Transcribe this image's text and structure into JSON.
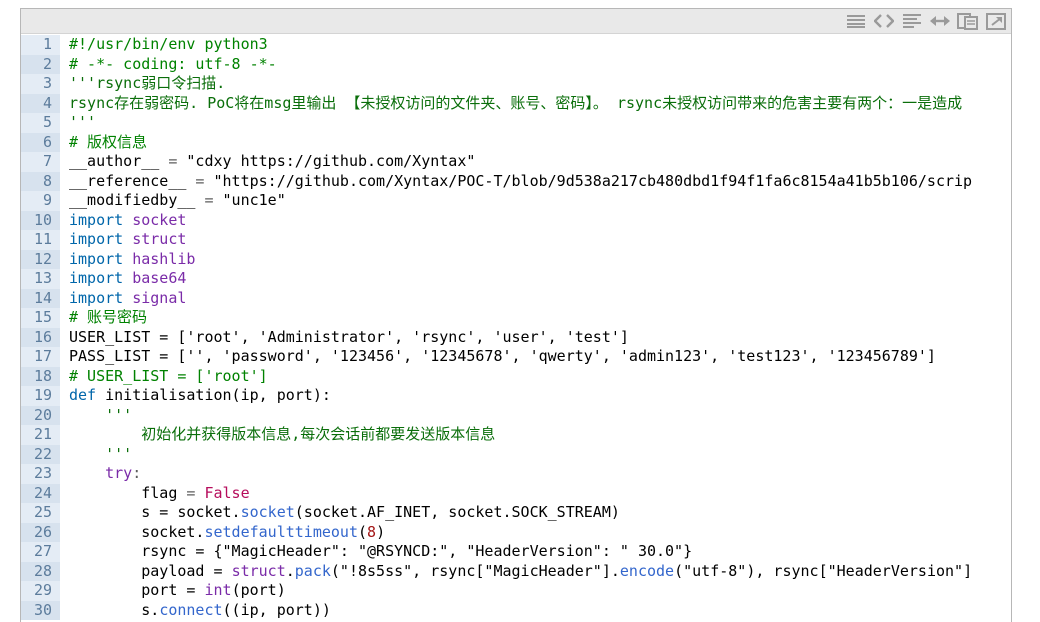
{
  "toolbar": {
    "tools": [
      "view-source-icon",
      "code-tags-icon",
      "wrap-lines-icon",
      "expand-icon",
      "copy-icon",
      "popout-icon"
    ]
  },
  "lines": [
    {
      "n": "1",
      "seg": [
        {
          "t": "#!/usr/bin/env python3",
          "c": "cm"
        }
      ]
    },
    {
      "n": "2",
      "seg": [
        {
          "t": "# -*- coding: utf-8 -*-",
          "c": "cm"
        }
      ]
    },
    {
      "n": "3",
      "seg": [
        {
          "t": "'''rsync弱口令扫描.",
          "c": "st"
        }
      ]
    },
    {
      "n": "4",
      "seg": [
        {
          "t": "rsync存在弱密码. PoC将在msg里输出 【未授权访问的文件夹、账号、密码】。 rsync未授权访问带来的危害主要有两个：一是造成",
          "c": "st"
        }
      ]
    },
    {
      "n": "5",
      "seg": [
        {
          "t": "'''",
          "c": "st"
        }
      ]
    },
    {
      "n": "6",
      "seg": [
        {
          "t": "# 版权信息",
          "c": "cm"
        }
      ]
    },
    {
      "n": "7",
      "seg": [
        {
          "t": "__author__",
          "c": "id"
        },
        {
          "t": " = ",
          "c": "op"
        },
        {
          "t": "\"cdxy https://github.com/Xyntax\"",
          "c": "id"
        }
      ]
    },
    {
      "n": "8",
      "seg": [
        {
          "t": "__reference__",
          "c": "id"
        },
        {
          "t": " = ",
          "c": "op"
        },
        {
          "t": "\"https://github.com/Xyntax/POC-T/blob/9d538a217cb480dbd1f94f1fa6c8154a41b5b106/scrip",
          "c": "id"
        }
      ]
    },
    {
      "n": "9",
      "seg": [
        {
          "t": "__modifiedby__",
          "c": "id"
        },
        {
          "t": " = ",
          "c": "op"
        },
        {
          "t": "\"unc1e\"",
          "c": "id"
        }
      ]
    },
    {
      "n": "10",
      "seg": [
        {
          "t": "import ",
          "c": "kw"
        },
        {
          "t": "socket",
          "c": "pk"
        }
      ]
    },
    {
      "n": "11",
      "seg": [
        {
          "t": "import ",
          "c": "kw"
        },
        {
          "t": "struct",
          "c": "pk"
        }
      ]
    },
    {
      "n": "12",
      "seg": [
        {
          "t": "import ",
          "c": "kw"
        },
        {
          "t": "hashlib",
          "c": "pk"
        }
      ]
    },
    {
      "n": "13",
      "seg": [
        {
          "t": "import ",
          "c": "kw"
        },
        {
          "t": "base64",
          "c": "pk"
        }
      ]
    },
    {
      "n": "14",
      "seg": [
        {
          "t": "import ",
          "c": "kw"
        },
        {
          "t": "signal",
          "c": "pk"
        }
      ]
    },
    {
      "n": "15",
      "seg": [
        {
          "t": "# 账号密码",
          "c": "cm"
        }
      ]
    },
    {
      "n": "16",
      "seg": [
        {
          "t": "USER_LIST = ['root', 'Administrator', 'rsync', 'user', 'test']",
          "c": "id"
        }
      ]
    },
    {
      "n": "17",
      "seg": [
        {
          "t": "PASS_LIST = ['', 'password', '123456', '12345678', 'qwerty', 'admin123', 'test123', '123456789']",
          "c": "id"
        }
      ]
    },
    {
      "n": "18",
      "seg": [
        {
          "t": "# USER_LIST = ['root']",
          "c": "cm"
        }
      ]
    },
    {
      "n": "19",
      "seg": [
        {
          "t": "def ",
          "c": "kw"
        },
        {
          "t": "initialisation(ip, port):",
          "c": "id"
        }
      ]
    },
    {
      "n": "20",
      "seg": [
        {
          "t": "    '''",
          "c": "st"
        }
      ]
    },
    {
      "n": "21",
      "seg": [
        {
          "t": "        初始化并获得版本信息,每次会话前都要发送版本信息",
          "c": "st"
        }
      ]
    },
    {
      "n": "22",
      "seg": [
        {
          "t": "    '''",
          "c": "st"
        }
      ]
    },
    {
      "n": "23",
      "seg": [
        {
          "t": "    try",
          "c": "pk"
        },
        {
          "t": ":",
          "c": "op"
        }
      ]
    },
    {
      "n": "24",
      "seg": [
        {
          "t": "        flag ",
          "c": "id"
        },
        {
          "t": "= ",
          "c": "op"
        },
        {
          "t": "False",
          "c": "kv"
        }
      ]
    },
    {
      "n": "25",
      "seg": [
        {
          "t": "        s = socket.",
          "c": "id"
        },
        {
          "t": "socket",
          "c": "mt"
        },
        {
          "t": "(socket.AF_INET, socket.SOCK_STREAM)",
          "c": "id"
        }
      ]
    },
    {
      "n": "26",
      "seg": [
        {
          "t": "        socket.",
          "c": "id"
        },
        {
          "t": "setdefaulttimeout",
          "c": "mt"
        },
        {
          "t": "(",
          "c": "id"
        },
        {
          "t": "8",
          "c": "num"
        },
        {
          "t": ")",
          "c": "id"
        }
      ]
    },
    {
      "n": "27",
      "seg": [
        {
          "t": "        rsync = {\"MagicHeader\": \"@RSYNCD:\", \"HeaderVersion\": \" 30.0\"}",
          "c": "id"
        }
      ]
    },
    {
      "n": "28",
      "seg": [
        {
          "t": "        payload = ",
          "c": "id"
        },
        {
          "t": "struct",
          "c": "pk"
        },
        {
          "t": ".",
          "c": "id"
        },
        {
          "t": "pack",
          "c": "mt"
        },
        {
          "t": "(\"!8s5ss\", rsync[\"MagicHeader\"].",
          "c": "id"
        },
        {
          "t": "encode",
          "c": "mt"
        },
        {
          "t": "(\"utf-8\"), rsync[\"HeaderVersion\"]",
          "c": "id"
        }
      ]
    },
    {
      "n": "29",
      "seg": [
        {
          "t": "        port = ",
          "c": "id"
        },
        {
          "t": "int",
          "c": "pk"
        },
        {
          "t": "(port)",
          "c": "id"
        }
      ]
    },
    {
      "n": "30",
      "seg": [
        {
          "t": "        s.",
          "c": "id"
        },
        {
          "t": "connect",
          "c": "mt"
        },
        {
          "t": "((ip, port))",
          "c": "id"
        }
      ]
    }
  ]
}
